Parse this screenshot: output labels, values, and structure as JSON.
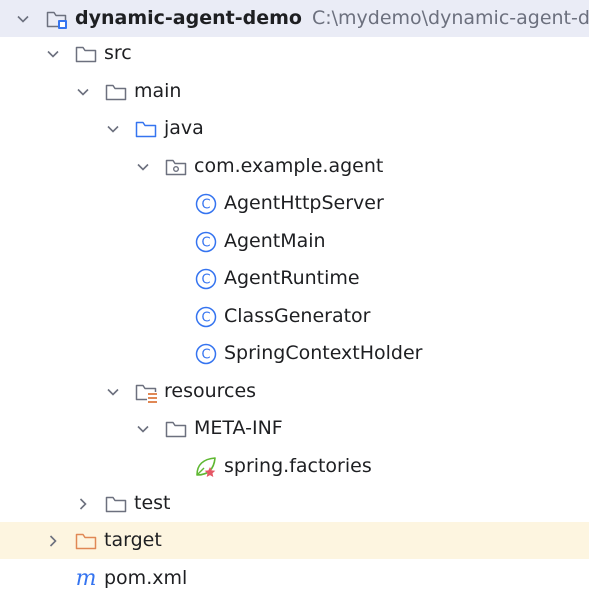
{
  "project": {
    "name": "dynamic-agent-demo",
    "path": "C:\\mydemo\\dynamic-agent-d"
  },
  "tree": {
    "src": "src",
    "main": "main",
    "java": "java",
    "package": "com.example.agent",
    "classes": [
      "AgentHttpServer",
      "AgentMain",
      "AgentRuntime",
      "ClassGenerator",
      "SpringContextHolder"
    ],
    "resources": "resources",
    "meta_inf": "META-INF",
    "spring_factories": "spring.factories",
    "test": "test",
    "target": "target",
    "pom": "pom.xml"
  },
  "colors": {
    "selection": "#eaecf6",
    "excluded": "#fdf5e0",
    "class_icon": "#3574f0",
    "target_folder": "#e08855",
    "maven": "#3574f0",
    "spring_leaf": "#5fb832",
    "spring_star": "#e55765"
  },
  "icons": {
    "expanded": "chevron-down-icon",
    "collapsed": "chevron-right-icon",
    "module": "module-folder-icon",
    "folder": "folder-icon",
    "source_root": "source-root-folder-icon",
    "package": "package-icon",
    "class": "class-icon",
    "resources_root": "resources-root-folder-icon",
    "spring": "spring-factories-icon",
    "excluded_folder": "excluded-folder-icon",
    "maven": "maven-icon"
  }
}
